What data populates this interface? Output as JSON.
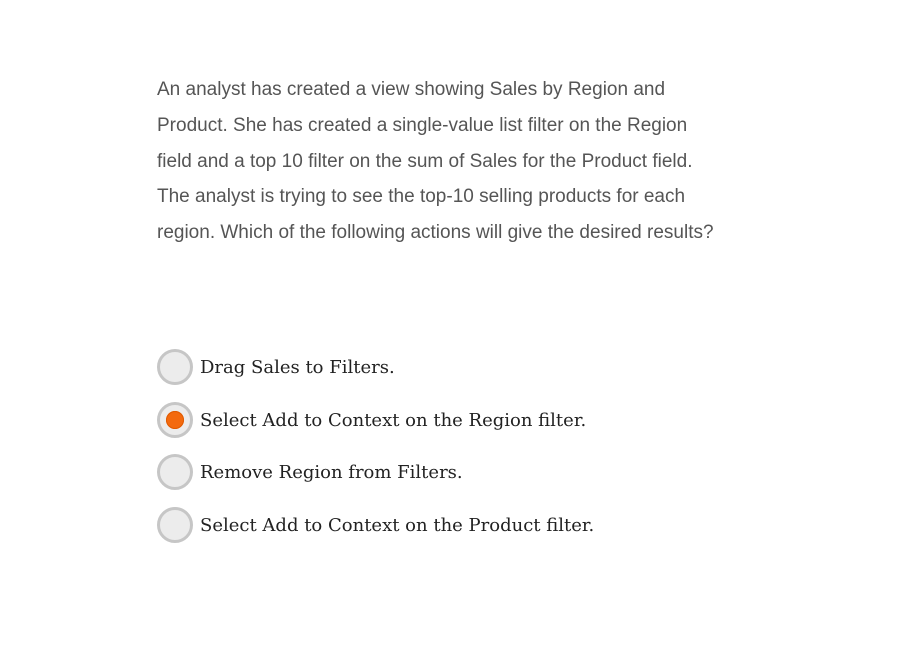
{
  "question": {
    "paragraph_1": "An analyst has created a view showing Sales by Region and Product. She has created a single-value list filter on the Region field and a top 10 filter on the sum of Sales for the Product field.",
    "paragraph_2": "The analyst is trying to see the top-10 selling products for each region. Which of the following actions will give the desired results?"
  },
  "options": [
    {
      "label": "Drag Sales to Filters.",
      "selected": false
    },
    {
      "label": "Select Add to Context on the Region filter.",
      "selected": true
    },
    {
      "label": "Remove Region from Filters.",
      "selected": false
    },
    {
      "label": "Select Add to Context on the Product filter.",
      "selected": false
    }
  ],
  "colors": {
    "selected_dot": "#f36a0f",
    "radio_border": "#c6c6c6",
    "radio_fill": "#ececec",
    "question_text": "#555555",
    "option_text": "#222222"
  }
}
